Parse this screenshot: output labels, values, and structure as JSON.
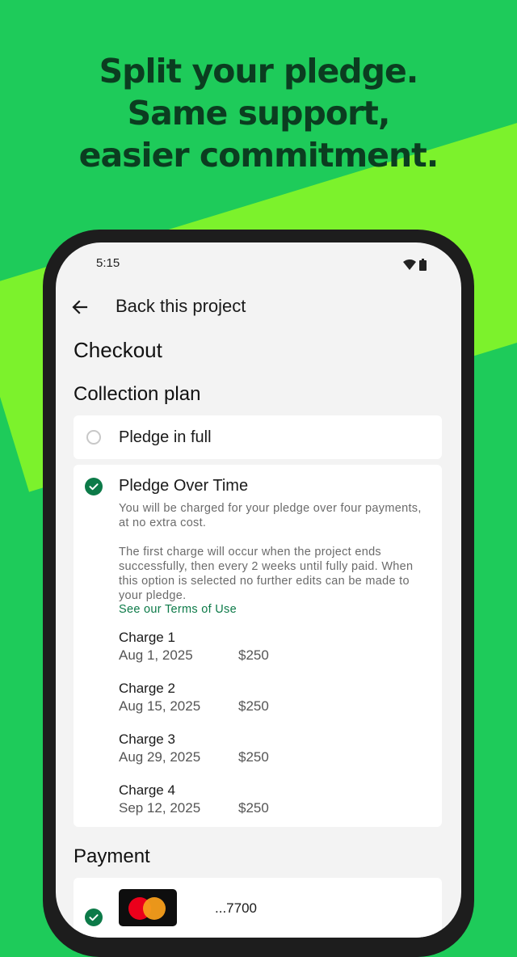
{
  "headline": {
    "line1": "Split your pledge.",
    "line2": "Same support,",
    "line3": "easier commitment."
  },
  "status_bar": {
    "time": "5:15",
    "icons": [
      "wifi-icon",
      "battery-icon"
    ]
  },
  "app_bar": {
    "back_icon": "arrow-left-icon",
    "title": "Back this project"
  },
  "checkout": {
    "heading": "Checkout",
    "collection_plan": {
      "heading": "Collection plan",
      "options": [
        {
          "label": "Pledge in full",
          "selected": false
        },
        {
          "label": "Pledge Over Time",
          "selected": true,
          "description1": "You will be charged for your pledge over four payments, at no extra cost.",
          "description2": "The first charge will occur when the project ends successfully, then every 2 weeks until fully paid. When this option is selected no further edits can be made to your pledge.",
          "terms_link": "See our Terms of Use",
          "charges": [
            {
              "label": "Charge 1",
              "date": "Aug 1, 2025",
              "amount": "$250"
            },
            {
              "label": "Charge 2",
              "date": "Aug 15, 2025",
              "amount": "$250"
            },
            {
              "label": "Charge 3",
              "date": "Aug 29, 2025",
              "amount": "$250"
            },
            {
              "label": "Charge 4",
              "date": "Sep 12, 2025",
              "amount": "$250"
            }
          ]
        }
      ]
    },
    "payment": {
      "heading": "Payment",
      "card_brand": "mastercard-logo",
      "card_number": "...7700",
      "selected": true
    }
  },
  "colors": {
    "background": "#1ecb5a",
    "stripe": "#7cf22c",
    "headline": "#0b3d20",
    "accent": "#0c7a48"
  }
}
